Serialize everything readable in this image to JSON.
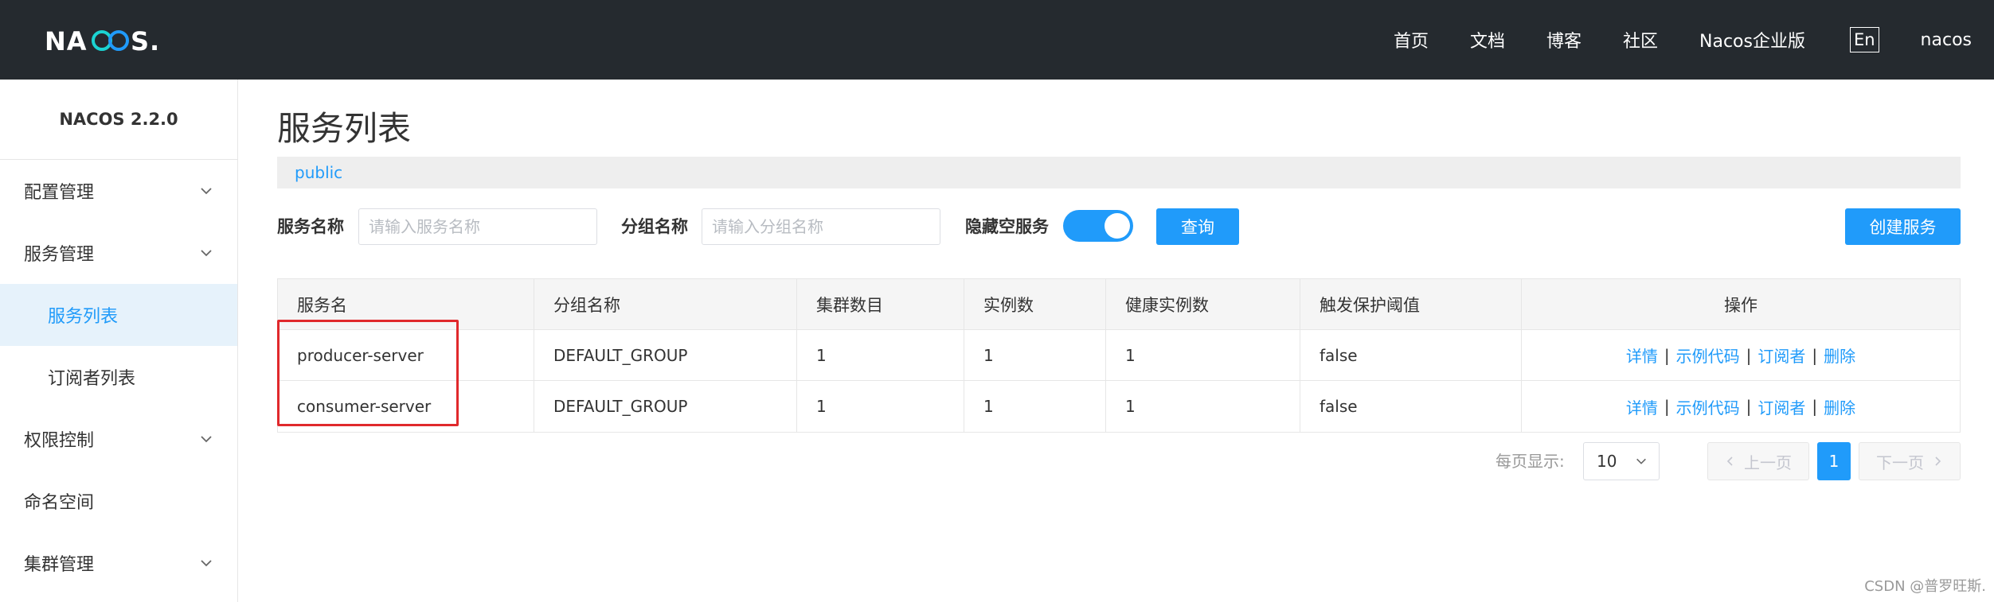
{
  "header": {
    "logo_text": "NACOS.",
    "nav": [
      "首页",
      "文档",
      "博客",
      "社区",
      "Nacos企业版"
    ],
    "lang_button": "En",
    "user": "nacos"
  },
  "sidebar": {
    "version": "NACOS 2.2.0",
    "items": [
      {
        "label": "配置管理",
        "has_arrow": true
      },
      {
        "label": "服务管理",
        "has_arrow": true
      },
      {
        "label": "服务列表",
        "sub": true,
        "active": true
      },
      {
        "label": "订阅者列表",
        "sub": true
      },
      {
        "label": "权限控制",
        "has_arrow": true
      },
      {
        "label": "命名空间"
      },
      {
        "label": "集群管理",
        "has_arrow": true
      }
    ]
  },
  "main": {
    "title": "服务列表",
    "namespace": "public",
    "filters": {
      "service_name_label": "服务名称",
      "service_name_placeholder": "请输入服务名称",
      "group_name_label": "分组名称",
      "group_name_placeholder": "请输入分组名称",
      "hide_empty_label": "隐藏空服务",
      "hide_empty_on": true,
      "query_button": "查询",
      "create_button": "创建服务"
    },
    "table": {
      "columns": [
        "服务名",
        "分组名称",
        "集群数目",
        "实例数",
        "健康实例数",
        "触发保护阈值",
        "操作"
      ],
      "rows": [
        [
          "producer-server",
          "DEFAULT_GROUP",
          "1",
          "1",
          "1",
          "false"
        ],
        [
          "consumer-server",
          "DEFAULT_GROUP",
          "1",
          "1",
          "1",
          "false"
        ]
      ],
      "actions": [
        "详情",
        "示例代码",
        "订阅者",
        "删除"
      ]
    },
    "pagination": {
      "page_size_label": "每页显示:",
      "page_size": "10",
      "prev": "上一页",
      "current_page": "1",
      "next": "下一页"
    }
  },
  "watermark": "CSDN @普罗旺斯.",
  "colors": {
    "header_bg": "#252a2f",
    "accent": "#209bfa",
    "highlight": "#e0292c",
    "active_menu_bg": "#e6f2fb"
  }
}
